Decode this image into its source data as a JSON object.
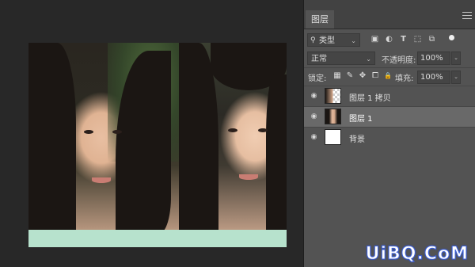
{
  "panel": {
    "tab_label": "图层",
    "filter": {
      "search_symbol": "⚲",
      "kind_label": "类型",
      "caret": "⌄"
    },
    "blend": {
      "mode": "正常",
      "caret": "⌄",
      "opacity_label": "不透明度:",
      "opacity_value": "100%",
      "step_caret": "⌄"
    },
    "lock": {
      "label": "锁定:",
      "fill_label": "填充:",
      "fill_value": "100%",
      "step_caret": "⌄"
    },
    "layers": [
      {
        "name": "图层 1 拷贝",
        "selected": false,
        "visible": true,
        "thumb": "photo-transparent"
      },
      {
        "name": "图层 1",
        "selected": true,
        "visible": true,
        "thumb": "photo"
      },
      {
        "name": "背景",
        "selected": false,
        "visible": true,
        "thumb": "white"
      }
    ]
  },
  "icons": {
    "image_filter": "▣",
    "adjustment_filter": "◐",
    "type_filter": "T",
    "shape_filter": "⬚",
    "smart_filter": "⧉",
    "lock_pixels": "▦",
    "lock_paint": "✎",
    "lock_move": "✥",
    "lock_artboard": "⧠",
    "lock_all": "🔒",
    "eye": "◉"
  },
  "watermark": "UiBQ.CoM",
  "colors": {
    "panel_bg": "#535353",
    "selected_layer": "#696969",
    "canvas_bg": "#282828",
    "watermark_stroke": "#3b5fd8"
  }
}
